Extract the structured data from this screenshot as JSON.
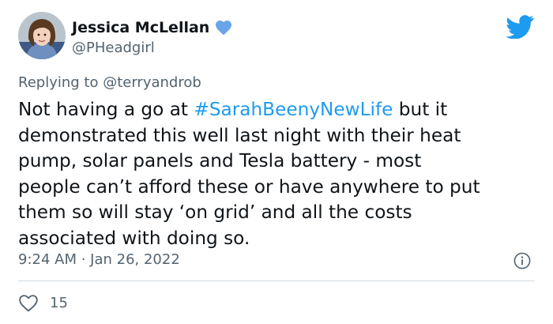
{
  "author": {
    "display_name": "Jessica McLellan",
    "handle": "@PHeadgirl",
    "verified": true,
    "avatar_icon": "profile-photo"
  },
  "reply": {
    "prefix": "Replying to ",
    "mention": "@terryandrob"
  },
  "tweet": {
    "lines": [
      {
        "before": "Not having a go at ",
        "hashtag": "#SarahBeenyNewLife",
        "after": " but it"
      },
      {
        "text": "demonstrated this well last night with their heat"
      },
      {
        "text": "pump, solar panels and Tesla battery - most"
      },
      {
        "text": "people can’t afford these or have anywhere to put"
      },
      {
        "text": "them so will stay ‘on grid’ and all the costs"
      },
      {
        "text": "associated with doing so."
      }
    ]
  },
  "meta": {
    "timestamp": "9:24 AM · Jan 26, 2022"
  },
  "engagement": {
    "likes": "15"
  },
  "icons": {
    "brand": "twitter-bird-icon",
    "verified": "verified-badge-icon",
    "info": "info-icon",
    "like": "heart-icon"
  },
  "colors": {
    "accent": "#1d9bf0",
    "text": "#0f1419",
    "secondary": "#536471",
    "divider": "#cfd9de"
  }
}
